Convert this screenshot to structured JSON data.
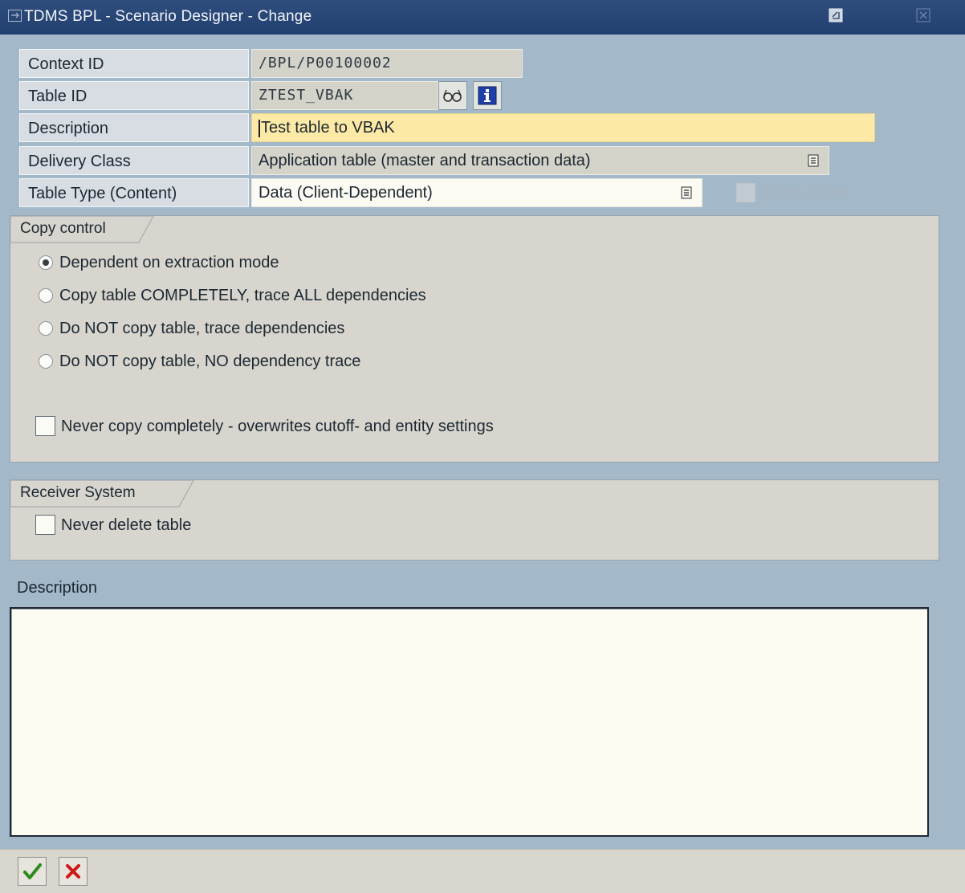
{
  "window": {
    "title": "TDMS BPL - Scenario Designer - Change"
  },
  "fields": {
    "context_id": {
      "label": "Context ID",
      "value": "/BPL/P00100002"
    },
    "table_id": {
      "label": "Table ID",
      "value": "ZTEST_VBAK"
    },
    "description": {
      "label": "Description",
      "value": "Test table to VBAK"
    },
    "delivery_class": {
      "label": "Delivery Class",
      "value": "Application table (master and transaction data)"
    },
    "table_type": {
      "label": "Table Type (Content)",
      "value": "Data (Client-Dependent)"
    },
    "cross_client": {
      "label": "Cross-Client",
      "checked": false,
      "enabled": false
    }
  },
  "copy_control": {
    "title": "Copy control",
    "options": [
      {
        "label": "Dependent on extraction mode",
        "selected": true
      },
      {
        "label": "Copy table COMPLETELY, trace ALL dependencies",
        "selected": false
      },
      {
        "label": "Do NOT copy table, trace dependencies",
        "selected": false
      },
      {
        "label": "Do NOT copy table, NO dependency trace",
        "selected": false
      }
    ],
    "never_copy": {
      "label": "Never copy completely - overwrites cutoff- and entity settings",
      "checked": false
    }
  },
  "receiver_system": {
    "title": "Receiver System",
    "never_delete": {
      "label": "Never delete table",
      "checked": false
    }
  },
  "long_description": {
    "label": "Description",
    "text": ""
  },
  "footer": {
    "buttons": [
      {
        "icon": "checkmark-icon",
        "action": "confirm"
      },
      {
        "icon": "cancel-x-icon",
        "action": "cancel"
      }
    ]
  },
  "colors": {
    "title_bar": "#22406f",
    "window_bg": "#a3b8c9",
    "required_field": "#fce9a6",
    "group_bg": "#d7d5cd"
  }
}
